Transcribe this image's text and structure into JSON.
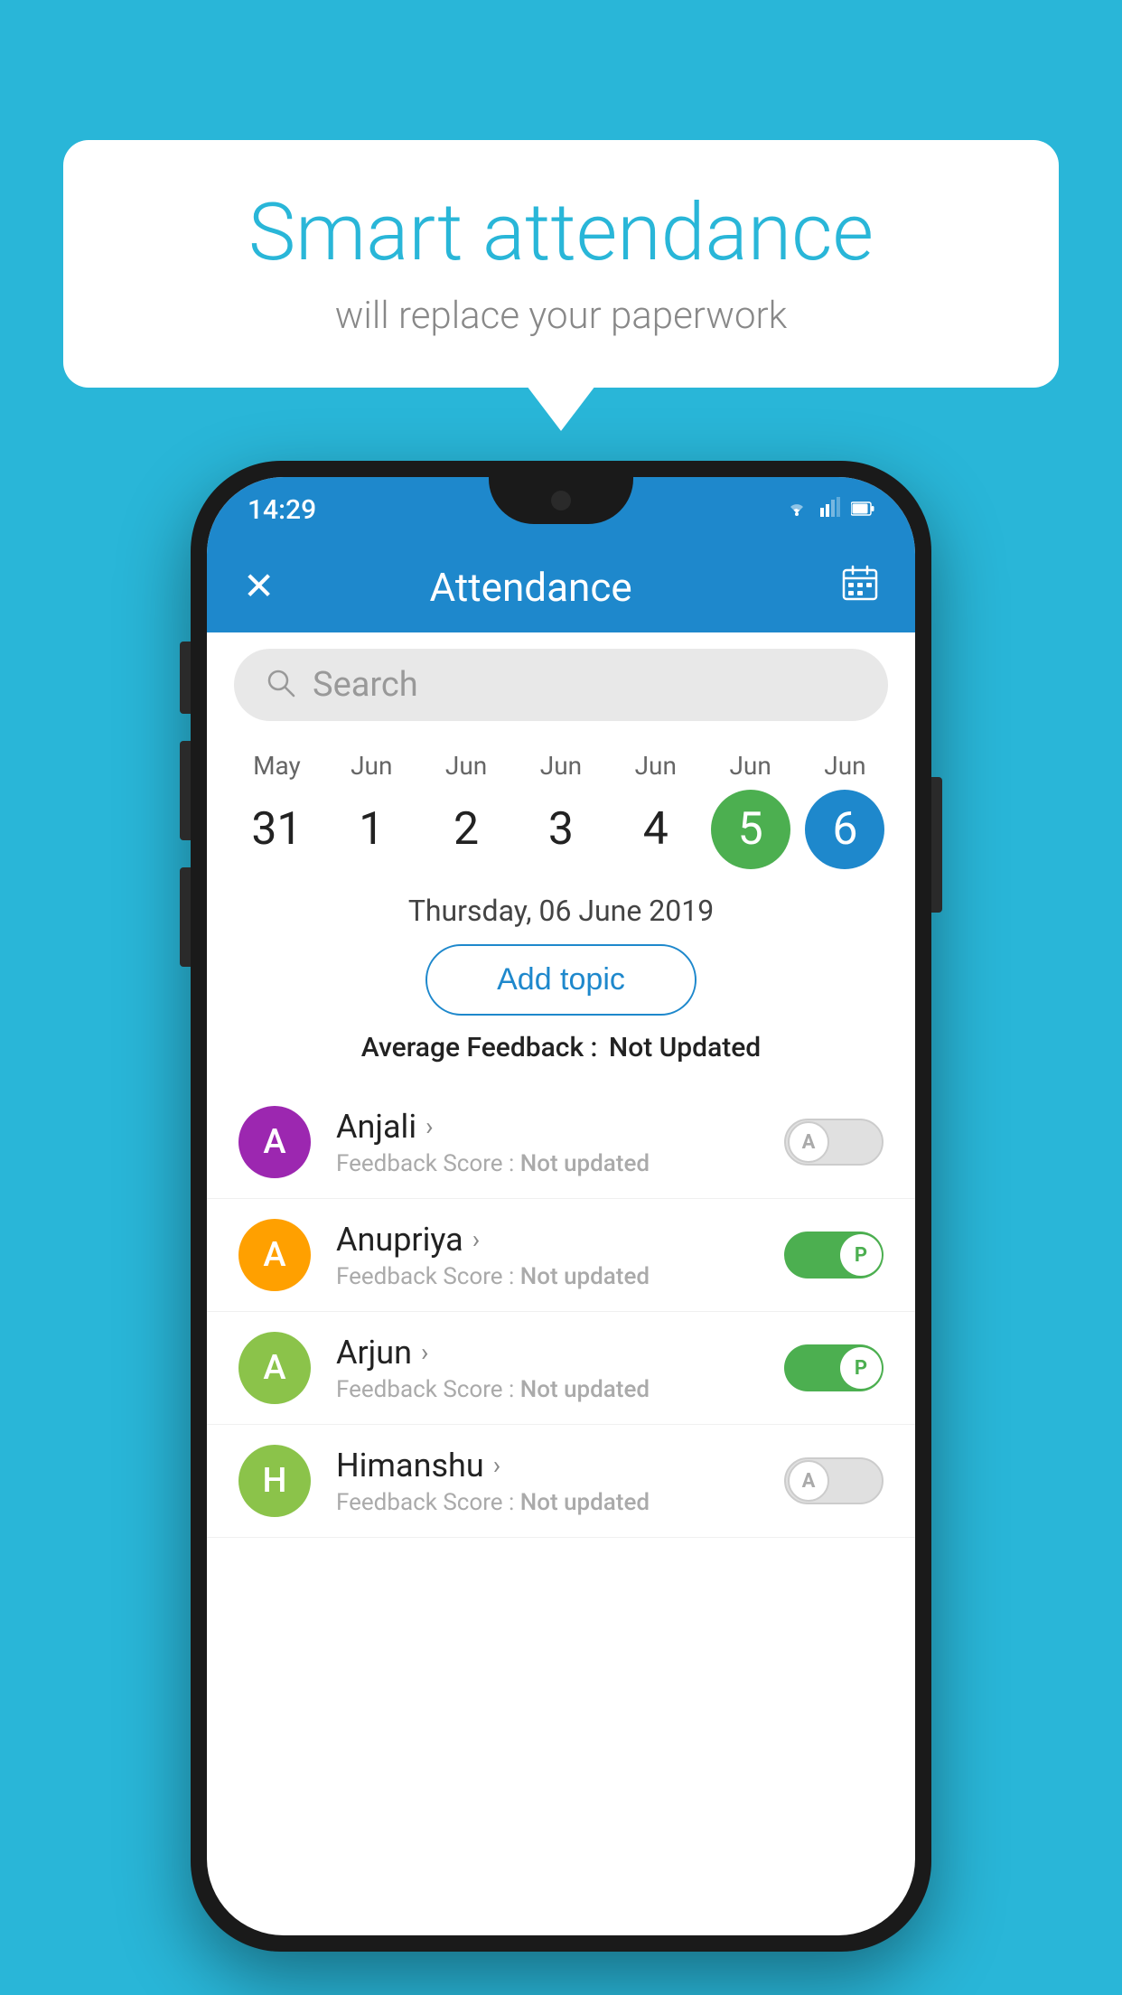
{
  "background": {
    "color": "#29b6d8"
  },
  "bubble": {
    "title": "Smart attendance",
    "subtitle": "will replace your paperwork"
  },
  "phone": {
    "status_bar": {
      "time": "14:29",
      "wifi": "▾",
      "signal": "▲",
      "battery": "▮"
    },
    "header": {
      "title": "Attendance",
      "close_label": "✕",
      "calendar_label": "📅"
    },
    "search": {
      "placeholder": "Search"
    },
    "calendar": {
      "days": [
        {
          "month": "May",
          "date": "31",
          "type": "normal"
        },
        {
          "month": "Jun",
          "date": "1",
          "type": "normal"
        },
        {
          "month": "Jun",
          "date": "2",
          "type": "normal"
        },
        {
          "month": "Jun",
          "date": "3",
          "type": "normal"
        },
        {
          "month": "Jun",
          "date": "4",
          "type": "normal"
        },
        {
          "month": "Jun",
          "date": "5",
          "type": "today"
        },
        {
          "month": "Jun",
          "date": "6",
          "type": "selected"
        }
      ]
    },
    "selected_date": "Thursday, 06 June 2019",
    "add_topic_label": "Add topic",
    "avg_feedback_label": "Average Feedback :",
    "avg_feedback_value": "Not Updated",
    "students": [
      {
        "name": "Anjali",
        "initial": "A",
        "avatar_color": "#9c27b0",
        "feedback_label": "Feedback Score :",
        "feedback_value": "Not updated",
        "attendance": "absent",
        "toggle_label": "A"
      },
      {
        "name": "Anupriya",
        "initial": "A",
        "avatar_color": "#ffa000",
        "feedback_label": "Feedback Score :",
        "feedback_value": "Not updated",
        "attendance": "present",
        "toggle_label": "P"
      },
      {
        "name": "Arjun",
        "initial": "A",
        "avatar_color": "#8bc34a",
        "feedback_label": "Feedback Score :",
        "feedback_value": "Not updated",
        "attendance": "present",
        "toggle_label": "P"
      },
      {
        "name": "Himanshu",
        "initial": "H",
        "avatar_color": "#8bc34a",
        "feedback_label": "Feedback Score :",
        "feedback_value": "Not updated",
        "attendance": "absent",
        "toggle_label": "A"
      }
    ]
  }
}
